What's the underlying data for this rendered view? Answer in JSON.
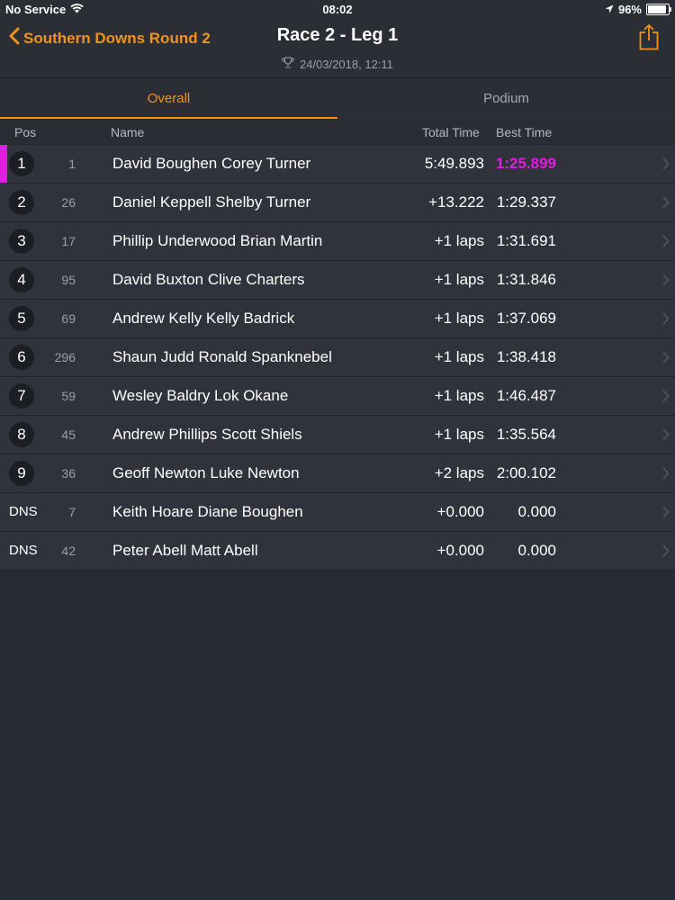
{
  "status": {
    "carrier": "No Service",
    "time": "08:02",
    "battery": "96%"
  },
  "nav": {
    "back_label": "Southern Downs Round 2",
    "title": "Race 2 -  Leg 1",
    "subtitle": "24/03/2018, 12:11"
  },
  "tabs": [
    {
      "label": "Overall",
      "active": true
    },
    {
      "label": "Podium",
      "active": false
    }
  ],
  "columns": {
    "pos": "Pos",
    "name": "Name",
    "total": "Total Time",
    "best": "Best Time"
  },
  "colors": {
    "accent": "#f2921a",
    "fastest": "#e11de0",
    "background": "#262a33"
  },
  "rows": [
    {
      "pos": "1",
      "num": "1",
      "name": "David Boughen Corey Turner",
      "total": "5:49.893",
      "best": "1:25.899",
      "fastest": true
    },
    {
      "pos": "2",
      "num": "26",
      "name": "Daniel Keppell Shelby Turner",
      "total": "+13.222",
      "best": "1:29.337"
    },
    {
      "pos": "3",
      "num": "17",
      "name": "Phillip Underwood Brian Martin",
      "total": "+1 laps",
      "best": "1:31.691"
    },
    {
      "pos": "4",
      "num": "95",
      "name": "David Buxton Clive Charters",
      "total": "+1 laps",
      "best": "1:31.846"
    },
    {
      "pos": "5",
      "num": "69",
      "name": "Andrew Kelly Kelly Badrick",
      "total": "+1 laps",
      "best": "1:37.069"
    },
    {
      "pos": "6",
      "num": "296",
      "name": "Shaun Judd Ronald Spanknebel",
      "total": "+1 laps",
      "best": "1:38.418"
    },
    {
      "pos": "7",
      "num": "59",
      "name": "Wesley Baldry Lok Okane",
      "total": "+1 laps",
      "best": "1:46.487"
    },
    {
      "pos": "8",
      "num": "45",
      "name": "Andrew Phillips Scott Shiels",
      "total": "+1 laps",
      "best": "1:35.564"
    },
    {
      "pos": "9",
      "num": "36",
      "name": "Geoff Newton Luke Newton",
      "total": "+2 laps",
      "best": "2:00.102"
    },
    {
      "pos": "DNS",
      "num": "7",
      "name": "Keith Hoare Diane Boughen",
      "total": "+0.000",
      "best": "0.000"
    },
    {
      "pos": "DNS",
      "num": "42",
      "name": "Peter Abell Matt Abell",
      "total": "+0.000",
      "best": "0.000"
    }
  ]
}
